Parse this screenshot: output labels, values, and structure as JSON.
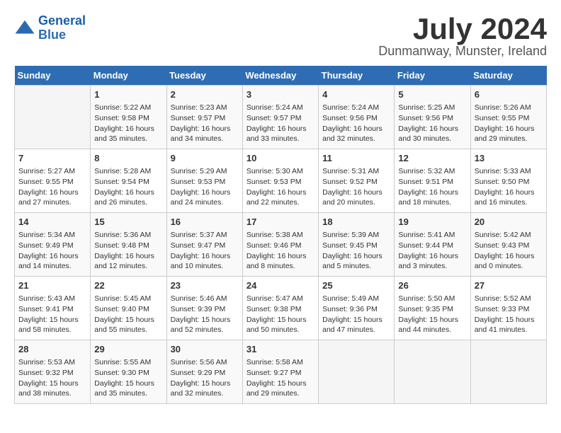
{
  "logo": {
    "line1": "General",
    "line2": "Blue"
  },
  "title": "July 2024",
  "location": "Dunmanway, Munster, Ireland",
  "days": [
    "Sunday",
    "Monday",
    "Tuesday",
    "Wednesday",
    "Thursday",
    "Friday",
    "Saturday"
  ],
  "weeks": [
    [
      {
        "date": "",
        "content": ""
      },
      {
        "date": "1",
        "content": "Sunrise: 5:22 AM\nSunset: 9:58 PM\nDaylight: 16 hours\nand 35 minutes."
      },
      {
        "date": "2",
        "content": "Sunrise: 5:23 AM\nSunset: 9:57 PM\nDaylight: 16 hours\nand 34 minutes."
      },
      {
        "date": "3",
        "content": "Sunrise: 5:24 AM\nSunset: 9:57 PM\nDaylight: 16 hours\nand 33 minutes."
      },
      {
        "date": "4",
        "content": "Sunrise: 5:24 AM\nSunset: 9:56 PM\nDaylight: 16 hours\nand 32 minutes."
      },
      {
        "date": "5",
        "content": "Sunrise: 5:25 AM\nSunset: 9:56 PM\nDaylight: 16 hours\nand 30 minutes."
      },
      {
        "date": "6",
        "content": "Sunrise: 5:26 AM\nSunset: 9:55 PM\nDaylight: 16 hours\nand 29 minutes."
      }
    ],
    [
      {
        "date": "7",
        "content": "Sunrise: 5:27 AM\nSunset: 9:55 PM\nDaylight: 16 hours\nand 27 minutes."
      },
      {
        "date": "8",
        "content": "Sunrise: 5:28 AM\nSunset: 9:54 PM\nDaylight: 16 hours\nand 26 minutes."
      },
      {
        "date": "9",
        "content": "Sunrise: 5:29 AM\nSunset: 9:53 PM\nDaylight: 16 hours\nand 24 minutes."
      },
      {
        "date": "10",
        "content": "Sunrise: 5:30 AM\nSunset: 9:53 PM\nDaylight: 16 hours\nand 22 minutes."
      },
      {
        "date": "11",
        "content": "Sunrise: 5:31 AM\nSunset: 9:52 PM\nDaylight: 16 hours\nand 20 minutes."
      },
      {
        "date": "12",
        "content": "Sunrise: 5:32 AM\nSunset: 9:51 PM\nDaylight: 16 hours\nand 18 minutes."
      },
      {
        "date": "13",
        "content": "Sunrise: 5:33 AM\nSunset: 9:50 PM\nDaylight: 16 hours\nand 16 minutes."
      }
    ],
    [
      {
        "date": "14",
        "content": "Sunrise: 5:34 AM\nSunset: 9:49 PM\nDaylight: 16 hours\nand 14 minutes."
      },
      {
        "date": "15",
        "content": "Sunrise: 5:36 AM\nSunset: 9:48 PM\nDaylight: 16 hours\nand 12 minutes."
      },
      {
        "date": "16",
        "content": "Sunrise: 5:37 AM\nSunset: 9:47 PM\nDaylight: 16 hours\nand 10 minutes."
      },
      {
        "date": "17",
        "content": "Sunrise: 5:38 AM\nSunset: 9:46 PM\nDaylight: 16 hours\nand 8 minutes."
      },
      {
        "date": "18",
        "content": "Sunrise: 5:39 AM\nSunset: 9:45 PM\nDaylight: 16 hours\nand 5 minutes."
      },
      {
        "date": "19",
        "content": "Sunrise: 5:41 AM\nSunset: 9:44 PM\nDaylight: 16 hours\nand 3 minutes."
      },
      {
        "date": "20",
        "content": "Sunrise: 5:42 AM\nSunset: 9:43 PM\nDaylight: 16 hours\nand 0 minutes."
      }
    ],
    [
      {
        "date": "21",
        "content": "Sunrise: 5:43 AM\nSunset: 9:41 PM\nDaylight: 15 hours\nand 58 minutes."
      },
      {
        "date": "22",
        "content": "Sunrise: 5:45 AM\nSunset: 9:40 PM\nDaylight: 15 hours\nand 55 minutes."
      },
      {
        "date": "23",
        "content": "Sunrise: 5:46 AM\nSunset: 9:39 PM\nDaylight: 15 hours\nand 52 minutes."
      },
      {
        "date": "24",
        "content": "Sunrise: 5:47 AM\nSunset: 9:38 PM\nDaylight: 15 hours\nand 50 minutes."
      },
      {
        "date": "25",
        "content": "Sunrise: 5:49 AM\nSunset: 9:36 PM\nDaylight: 15 hours\nand 47 minutes."
      },
      {
        "date": "26",
        "content": "Sunrise: 5:50 AM\nSunset: 9:35 PM\nDaylight: 15 hours\nand 44 minutes."
      },
      {
        "date": "27",
        "content": "Sunrise: 5:52 AM\nSunset: 9:33 PM\nDaylight: 15 hours\nand 41 minutes."
      }
    ],
    [
      {
        "date": "28",
        "content": "Sunrise: 5:53 AM\nSunset: 9:32 PM\nDaylight: 15 hours\nand 38 minutes."
      },
      {
        "date": "29",
        "content": "Sunrise: 5:55 AM\nSunset: 9:30 PM\nDaylight: 15 hours\nand 35 minutes."
      },
      {
        "date": "30",
        "content": "Sunrise: 5:56 AM\nSunset: 9:29 PM\nDaylight: 15 hours\nand 32 minutes."
      },
      {
        "date": "31",
        "content": "Sunrise: 5:58 AM\nSunset: 9:27 PM\nDaylight: 15 hours\nand 29 minutes."
      },
      {
        "date": "",
        "content": ""
      },
      {
        "date": "",
        "content": ""
      },
      {
        "date": "",
        "content": ""
      }
    ]
  ]
}
